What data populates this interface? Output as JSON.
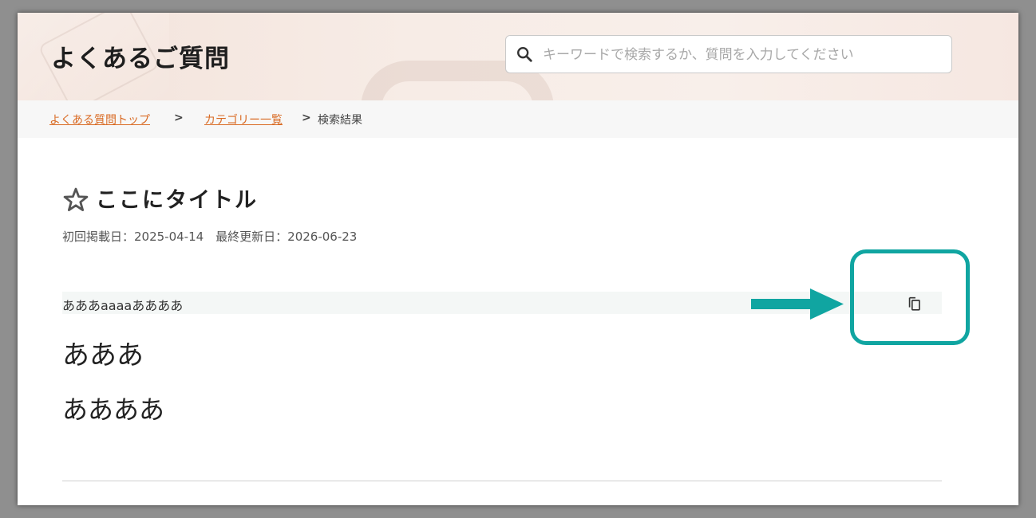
{
  "header": {
    "title": "よくあるご質問",
    "search_placeholder": "キーワードで検索するか、質問を入力してください",
    "search_value": ""
  },
  "breadcrumb": {
    "items": [
      {
        "label": "よくある質問トップ"
      },
      {
        "label": "カテゴリー一覧"
      }
    ],
    "separator": ">",
    "current": "検索結果"
  },
  "article": {
    "title": "ここにタイトル",
    "dates": "初回掲載日：2025-04-14　最終更新日：2026-06-23",
    "code_text": "あああaaaaああああ",
    "paragraph1": "あああ",
    "paragraph2": "ああああ"
  },
  "icons": {
    "search": "search-icon",
    "star": "star-icon",
    "copy": "copy-icon",
    "arrow": "arrow-right-icon"
  },
  "colors": {
    "accent_link": "#d96a23",
    "annotation": "#10a5a1",
    "header_bg": "#f6e9e3"
  }
}
